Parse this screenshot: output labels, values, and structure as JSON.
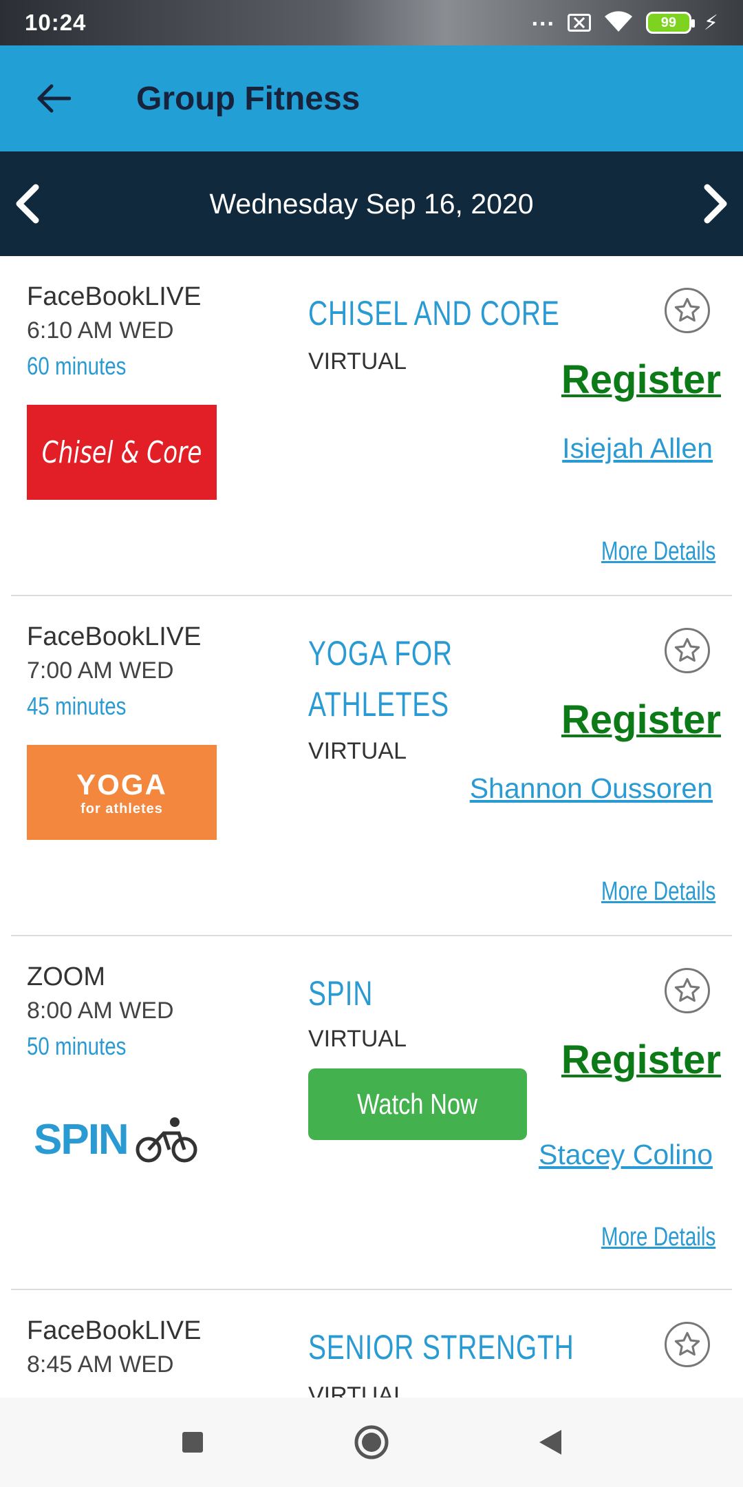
{
  "status_bar": {
    "time": "10:24",
    "dots": "...",
    "battery": "99"
  },
  "app_bar": {
    "title": "Group Fitness"
  },
  "date_nav": {
    "label": "Wednesday Sep 16, 2020"
  },
  "classes": [
    {
      "platform": "FaceBookLIVE",
      "time": "6:10 AM WED",
      "duration": "60 minutes",
      "title_lines": [
        "CHISEL AND CORE"
      ],
      "type": "VIRTUAL",
      "register": "Register",
      "instructor": "Isiejah Allen",
      "more": "More Details",
      "logo": "Chisel & Core"
    },
    {
      "platform": "FaceBookLIVE",
      "time": "7:00 AM WED",
      "duration": "45 minutes",
      "title_lines": [
        "YOGA FOR",
        "ATHLETES"
      ],
      "type": "VIRTUAL",
      "register": "Register",
      "instructor": "Shannon Oussoren",
      "more": "More Details",
      "logo": "YOGA",
      "logo_sub": "for athletes"
    },
    {
      "platform": "ZOOM",
      "time": "8:00 AM WED",
      "duration": "50 minutes",
      "title_lines": [
        "SPIN"
      ],
      "type": "VIRTUAL",
      "watch": "Watch Now",
      "register": "Register",
      "instructor": "Stacey Colino",
      "more": "More Details",
      "logo": "SPIN"
    },
    {
      "platform": "FaceBookLIVE",
      "time": "8:45 AM WED",
      "title_lines": [
        "SENIOR STRENGTH"
      ],
      "type": "VIRTUAL"
    }
  ],
  "colors": {
    "app_bar": "#22a0d6",
    "date_bar": "#11293d",
    "accent_blue": "#2a9ad3",
    "register_green": "#0c7a17",
    "watch_green": "#43b14e"
  }
}
